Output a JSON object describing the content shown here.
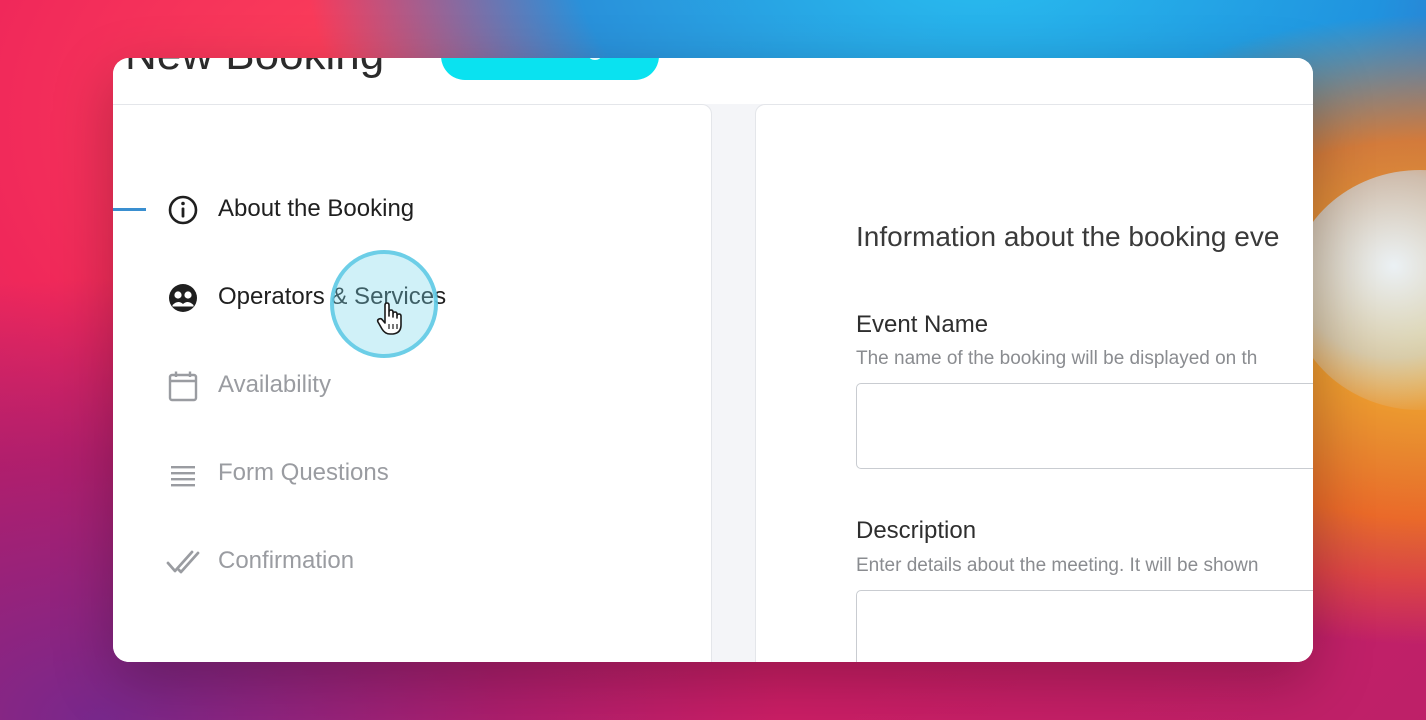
{
  "page": {
    "heading": "New Booking"
  },
  "sidebar": {
    "items": [
      {
        "label": "About the Booking",
        "icon": "info-circle-icon",
        "state": "active"
      },
      {
        "label": "Operators & Services",
        "icon": "operators-icon",
        "state": "hover"
      },
      {
        "label": "Availability",
        "icon": "calendar-icon",
        "state": "inactive"
      },
      {
        "label": "Form Questions",
        "icon": "list-lines-icon",
        "state": "inactive"
      },
      {
        "label": "Confirmation",
        "icon": "double-check-icon",
        "state": "inactive"
      }
    ]
  },
  "main": {
    "section_title": "Information about the booking eve",
    "fields": [
      {
        "label": "Event Name",
        "help": "The name of the booking will be displayed on th",
        "value": ""
      },
      {
        "label": "Description",
        "help": "Enter details about the meeting. It will be shown",
        "value": ""
      }
    ]
  },
  "colors": {
    "accent_indicator": "#3a8fd0",
    "top_button": "#0ae2f0",
    "active_text": "#1f1f1f",
    "inactive_text": "#9a9ca1",
    "cursor_ring": "#5ac8e4"
  }
}
